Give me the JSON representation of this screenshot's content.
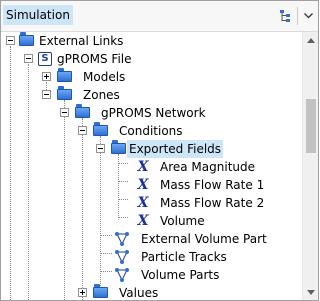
{
  "header": {
    "title": "Simulation"
  },
  "tree": {
    "nodes": [
      {
        "label": "External Links"
      },
      {
        "label": "gPROMS File"
      },
      {
        "label": "Models"
      },
      {
        "label": "Zones"
      },
      {
        "label": "gPROMS Network"
      },
      {
        "label": "Conditions"
      },
      {
        "label": "Exported Fields"
      },
      {
        "label": "Area Magnitude"
      },
      {
        "label": "Mass Flow Rate 1"
      },
      {
        "label": "Mass Flow Rate 2"
      },
      {
        "label": "Volume"
      },
      {
        "label": "External Volume Part"
      },
      {
        "label": "Particle Tracks"
      },
      {
        "label": "Volume Parts"
      },
      {
        "label": "Values"
      }
    ]
  },
  "colors": {
    "selection": "#cde6f7",
    "folder": "#2f6fd4",
    "field_icon": "#1a2fa0"
  }
}
